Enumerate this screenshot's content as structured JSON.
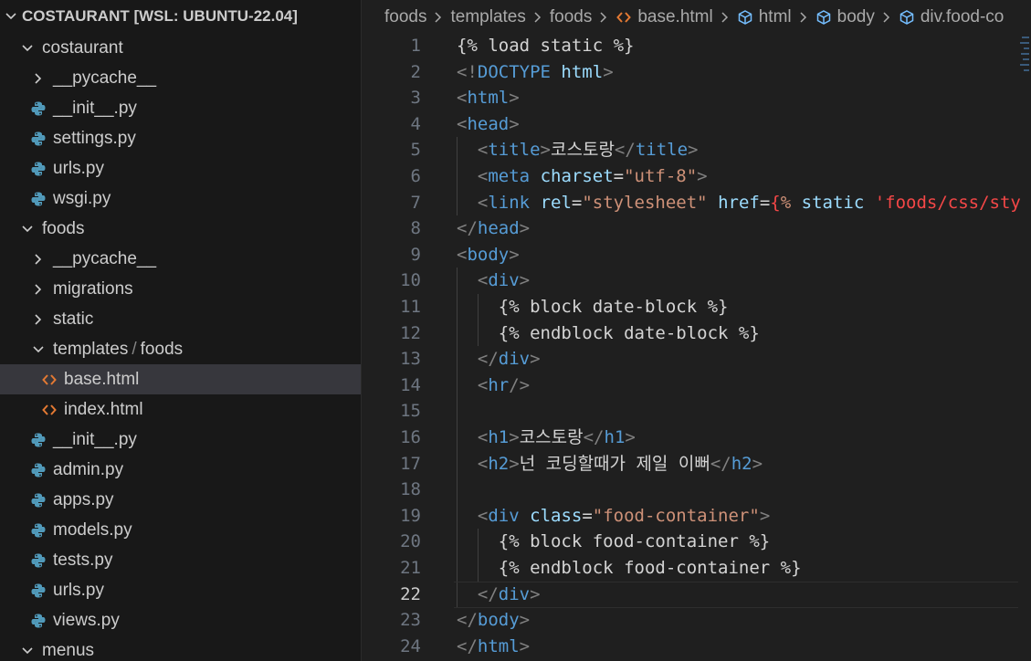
{
  "explorer": {
    "root_label": "COSTAURANT [WSL: UBUNTU-22.04]",
    "items": [
      {
        "label": "costaurant",
        "type": "folder-open",
        "depth": 1
      },
      {
        "label": "__pycache__",
        "type": "folder-closed",
        "depth": 2
      },
      {
        "label": "__init__.py",
        "type": "python",
        "depth": 2
      },
      {
        "label": "settings.py",
        "type": "python",
        "depth": 2
      },
      {
        "label": "urls.py",
        "type": "python",
        "depth": 2
      },
      {
        "label": "wsgi.py",
        "type": "python",
        "depth": 2
      },
      {
        "label": "foods",
        "type": "folder-open",
        "depth": 1
      },
      {
        "label": "__pycache__",
        "type": "folder-closed",
        "depth": 2
      },
      {
        "label": "migrations",
        "type": "folder-closed",
        "depth": 2
      },
      {
        "label": "static",
        "type": "folder-closed",
        "depth": 2
      },
      {
        "label": "templates",
        "label2": "foods",
        "type": "folder-open",
        "depth": 2
      },
      {
        "label": "base.html",
        "type": "html",
        "depth": 3,
        "selected": true
      },
      {
        "label": "index.html",
        "type": "html",
        "depth": 3
      },
      {
        "label": "__init__.py",
        "type": "python",
        "depth": 2
      },
      {
        "label": "admin.py",
        "type": "python",
        "depth": 2
      },
      {
        "label": "apps.py",
        "type": "python",
        "depth": 2
      },
      {
        "label": "models.py",
        "type": "python",
        "depth": 2
      },
      {
        "label": "tests.py",
        "type": "python",
        "depth": 2
      },
      {
        "label": "urls.py",
        "type": "python",
        "depth": 2
      },
      {
        "label": "views.py",
        "type": "python",
        "depth": 2
      },
      {
        "label": "menus",
        "type": "folder-open",
        "depth": 1
      }
    ]
  },
  "breadcrumb": [
    {
      "label": "foods",
      "icon": ""
    },
    {
      "label": "templates",
      "icon": ""
    },
    {
      "label": "foods",
      "icon": ""
    },
    {
      "label": "base.html",
      "icon": "html"
    },
    {
      "label": "html",
      "icon": "symbol"
    },
    {
      "label": "body",
      "icon": "symbol"
    },
    {
      "label": "div.food-co",
      "icon": "symbol"
    }
  ],
  "editor": {
    "active_line": 22,
    "lines": [
      {
        "n": "1",
        "indent": 0,
        "tokens": [
          {
            "t": "{% load static %}",
            "c": "tmpl"
          }
        ]
      },
      {
        "n": "2",
        "indent": 0,
        "tokens": [
          {
            "t": "<!",
            "c": "punct"
          },
          {
            "t": "DOCTYPE",
            "c": "tag"
          },
          {
            "t": " ",
            "c": "text"
          },
          {
            "t": "html",
            "c": "attr"
          },
          {
            "t": ">",
            "c": "punct"
          }
        ]
      },
      {
        "n": "3",
        "indent": 0,
        "tokens": [
          {
            "t": "<",
            "c": "punct"
          },
          {
            "t": "html",
            "c": "tag"
          },
          {
            "t": ">",
            "c": "punct"
          }
        ]
      },
      {
        "n": "4",
        "indent": 0,
        "tokens": [
          {
            "t": "<",
            "c": "punct"
          },
          {
            "t": "head",
            "c": "tag"
          },
          {
            "t": ">",
            "c": "punct"
          }
        ]
      },
      {
        "n": "5",
        "indent": 1,
        "tokens": [
          {
            "t": "<",
            "c": "punct"
          },
          {
            "t": "title",
            "c": "tag"
          },
          {
            "t": ">",
            "c": "punct"
          },
          {
            "t": "코스토랑",
            "c": "text"
          },
          {
            "t": "</",
            "c": "punct"
          },
          {
            "t": "title",
            "c": "tag"
          },
          {
            "t": ">",
            "c": "punct"
          }
        ]
      },
      {
        "n": "6",
        "indent": 1,
        "tokens": [
          {
            "t": "<",
            "c": "punct"
          },
          {
            "t": "meta",
            "c": "tag"
          },
          {
            "t": " ",
            "c": "text"
          },
          {
            "t": "charset",
            "c": "attr"
          },
          {
            "t": "=",
            "c": "text"
          },
          {
            "t": "\"utf-8\"",
            "c": "str"
          },
          {
            "t": ">",
            "c": "punct"
          }
        ]
      },
      {
        "n": "7",
        "indent": 1,
        "tokens": [
          {
            "t": "<",
            "c": "punct"
          },
          {
            "t": "link",
            "c": "tag"
          },
          {
            "t": " ",
            "c": "text"
          },
          {
            "t": "rel",
            "c": "attr"
          },
          {
            "t": "=",
            "c": "text"
          },
          {
            "t": "\"stylesheet\"",
            "c": "str"
          },
          {
            "t": " ",
            "c": "text"
          },
          {
            "t": "href",
            "c": "attr"
          },
          {
            "t": "=",
            "c": "text"
          },
          {
            "t": "{",
            "c": "brace"
          },
          {
            "t": "%",
            "c": "str"
          },
          {
            "t": " static ",
            "c": "attr"
          },
          {
            "t": "'foods/css/sty",
            "c": "brace"
          }
        ]
      },
      {
        "n": "8",
        "indent": 0,
        "tokens": [
          {
            "t": "</",
            "c": "punct"
          },
          {
            "t": "head",
            "c": "tag"
          },
          {
            "t": ">",
            "c": "punct"
          }
        ]
      },
      {
        "n": "9",
        "indent": 0,
        "tokens": [
          {
            "t": "<",
            "c": "punct"
          },
          {
            "t": "body",
            "c": "tag"
          },
          {
            "t": ">",
            "c": "punct"
          }
        ]
      },
      {
        "n": "10",
        "indent": 1,
        "tokens": [
          {
            "t": "<",
            "c": "punct"
          },
          {
            "t": "div",
            "c": "tag"
          },
          {
            "t": ">",
            "c": "punct"
          }
        ]
      },
      {
        "n": "11",
        "indent": 2,
        "tokens": [
          {
            "t": "{% block date-block %}",
            "c": "tmpl"
          }
        ]
      },
      {
        "n": "12",
        "indent": 2,
        "tokens": [
          {
            "t": "{% endblock date-block %}",
            "c": "tmpl"
          }
        ]
      },
      {
        "n": "13",
        "indent": 1,
        "tokens": [
          {
            "t": "</",
            "c": "punct"
          },
          {
            "t": "div",
            "c": "tag"
          },
          {
            "t": ">",
            "c": "punct"
          }
        ]
      },
      {
        "n": "14",
        "indent": 1,
        "tokens": [
          {
            "t": "<",
            "c": "punct"
          },
          {
            "t": "hr",
            "c": "tag"
          },
          {
            "t": "/>",
            "c": "punct"
          }
        ]
      },
      {
        "n": "15",
        "indent": 1,
        "tokens": []
      },
      {
        "n": "16",
        "indent": 1,
        "tokens": [
          {
            "t": "<",
            "c": "punct"
          },
          {
            "t": "h1",
            "c": "tag"
          },
          {
            "t": ">",
            "c": "punct"
          },
          {
            "t": "코스토랑",
            "c": "text"
          },
          {
            "t": "</",
            "c": "punct"
          },
          {
            "t": "h1",
            "c": "tag"
          },
          {
            "t": ">",
            "c": "punct"
          }
        ]
      },
      {
        "n": "17",
        "indent": 1,
        "tokens": [
          {
            "t": "<",
            "c": "punct"
          },
          {
            "t": "h2",
            "c": "tag"
          },
          {
            "t": ">",
            "c": "punct"
          },
          {
            "t": "넌 코딩할때가 제일 이뻐",
            "c": "text"
          },
          {
            "t": "</",
            "c": "punct"
          },
          {
            "t": "h2",
            "c": "tag"
          },
          {
            "t": ">",
            "c": "punct"
          }
        ]
      },
      {
        "n": "18",
        "indent": 1,
        "tokens": []
      },
      {
        "n": "19",
        "indent": 1,
        "tokens": [
          {
            "t": "<",
            "c": "punct"
          },
          {
            "t": "div",
            "c": "tag"
          },
          {
            "t": " ",
            "c": "text"
          },
          {
            "t": "class",
            "c": "attr"
          },
          {
            "t": "=",
            "c": "text"
          },
          {
            "t": "\"food-container\"",
            "c": "str"
          },
          {
            "t": ">",
            "c": "punct"
          }
        ]
      },
      {
        "n": "20",
        "indent": 2,
        "tokens": [
          {
            "t": "{% block food-container %}",
            "c": "tmpl"
          }
        ]
      },
      {
        "n": "21",
        "indent": 2,
        "tokens": [
          {
            "t": "{% endblock food-container %}",
            "c": "tmpl"
          }
        ]
      },
      {
        "n": "22",
        "indent": 1,
        "tokens": [
          {
            "t": "</",
            "c": "punct"
          },
          {
            "t": "div",
            "c": "tag"
          },
          {
            "t": ">",
            "c": "punct"
          }
        ]
      },
      {
        "n": "23",
        "indent": 0,
        "tokens": [
          {
            "t": "</",
            "c": "punct"
          },
          {
            "t": "body",
            "c": "tag"
          },
          {
            "t": ">",
            "c": "punct"
          }
        ]
      },
      {
        "n": "24",
        "indent": 0,
        "tokens": [
          {
            "t": "</",
            "c": "punct"
          },
          {
            "t": "html",
            "c": "tag"
          },
          {
            "t": ">",
            "c": "punct"
          }
        ]
      }
    ]
  },
  "colors": {
    "python_icon": "#519aba",
    "html_icon": "#e37933",
    "symbol_icon": "#75beff"
  }
}
